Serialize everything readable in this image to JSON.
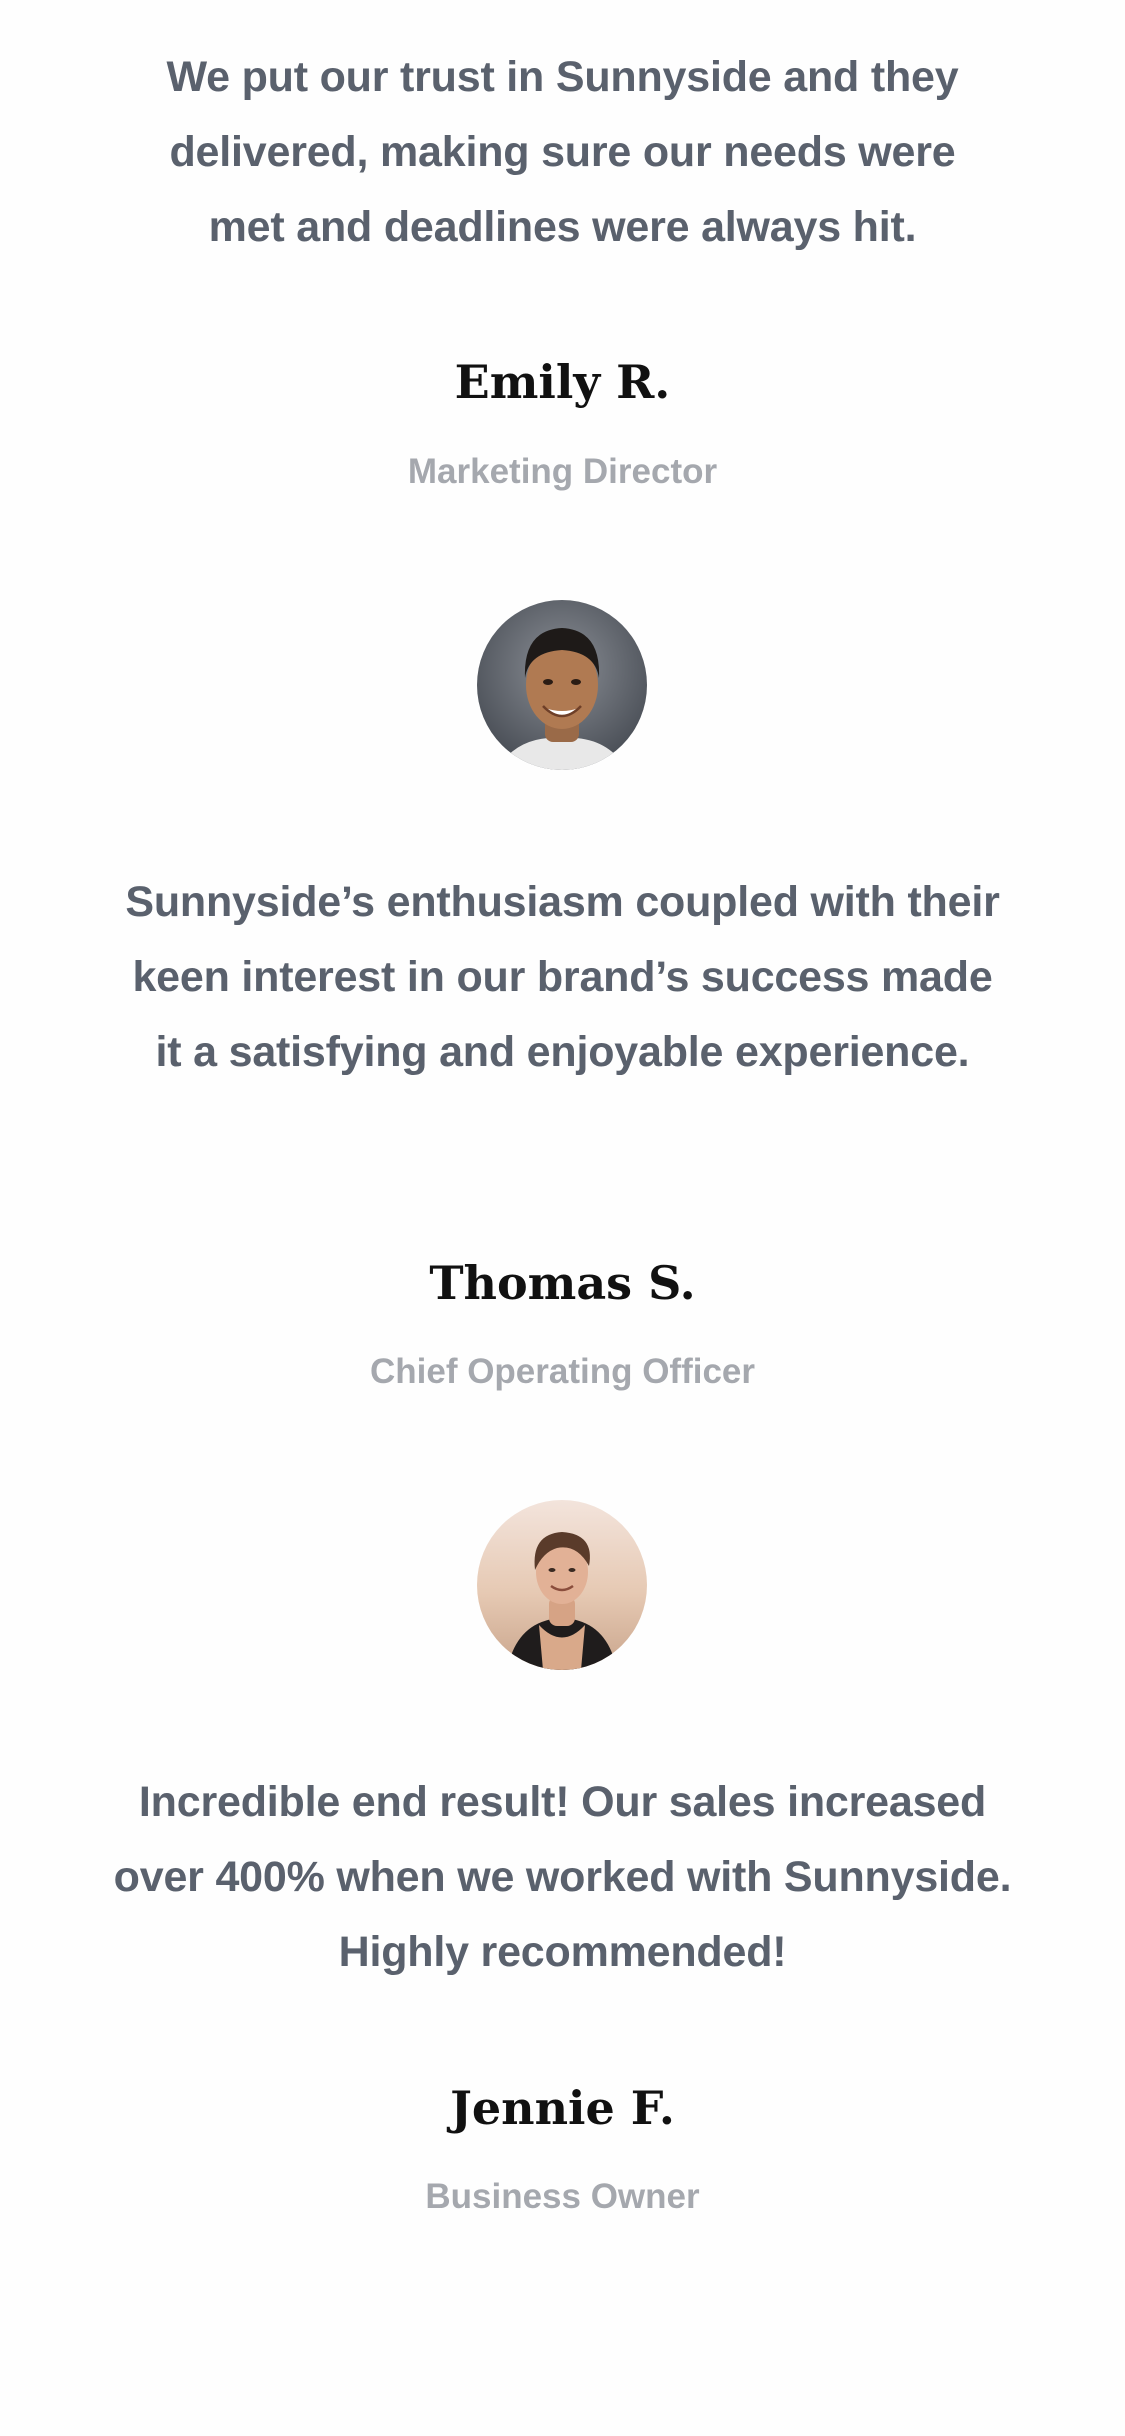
{
  "testimonials": [
    {
      "quote": "We put our trust in Sunnyside and they delivered, making sure our needs were met and deadlines were always hit.",
      "name": "Emily R.",
      "role": "Marketing Director"
    },
    {
      "avatar_icon": "person-photo-icon",
      "quote": "Sunnyside’s enthusiasm coupled with their keen interest in our brand’s success made it a satisfying and enjoyable experience.",
      "name": "Thomas S.",
      "role": "Chief Operating Officer"
    },
    {
      "avatar_icon": "person-photo-icon",
      "quote": "Incredible end result! Our sales increased over 400% when we worked with Sunnyside. Highly recommended!",
      "name": "Jennie F.",
      "role": "Business Owner"
    }
  ],
  "colors": {
    "background": "#fefefe",
    "quote_text": "#5a616d",
    "name_text": "#111111",
    "role_text": "#a5a8ae"
  }
}
